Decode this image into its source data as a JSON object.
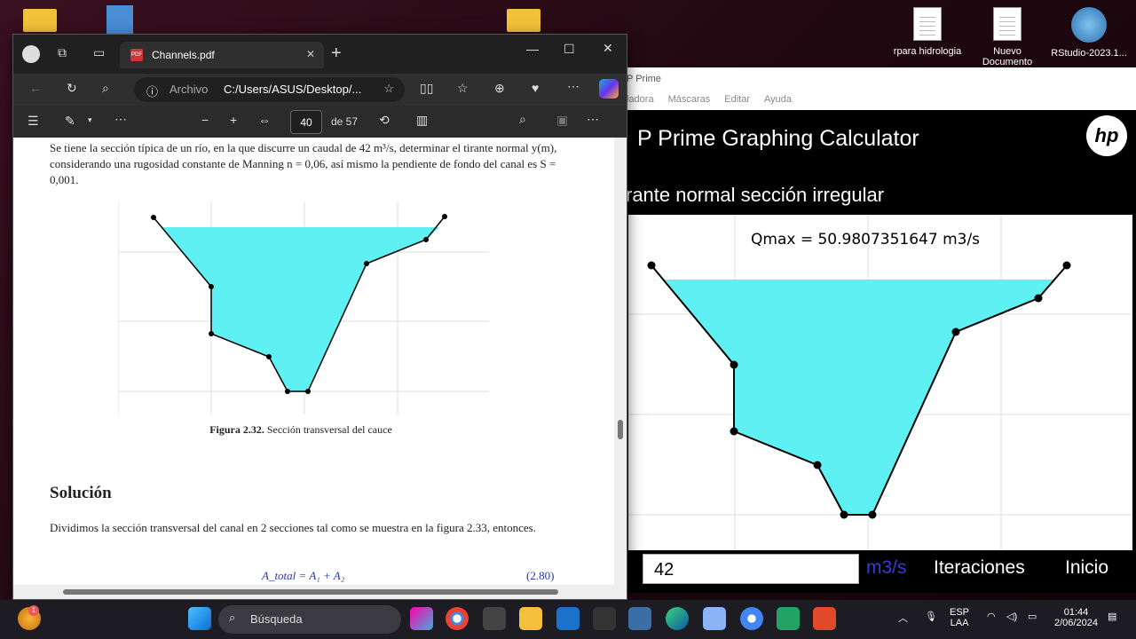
{
  "desktop": {
    "icons": [
      {
        "label": "rpara hidrologia",
        "type": "doc"
      },
      {
        "label": "Nuevo Documento",
        "type": "doc"
      },
      {
        "label": "RStudio-2023.1...",
        "type": "app"
      }
    ]
  },
  "browser": {
    "tab_title": "Channels.pdf",
    "address_label": "Archivo",
    "address_path": "C:/Users/ASUS/Desktop/...",
    "page_current": "40",
    "page_total": "de 57"
  },
  "pdf": {
    "para1": "Se tiene la sección típica de un río, en la que discurre un caudal de 42 m³/s, determinar el tirante normal y(m), considerando una rugosidad constante de Manning n = 0,06, así mismo la pendiente de fondo del canal es S = 0,001.",
    "fig_label": "Figura 2.32.",
    "fig_caption": "Sección transversal del cauce",
    "solution_heading": "Solución",
    "para2": "Dividimos la sección transversal del canal en 2 secciones tal como se muestra en la figura 2.33, entonces.",
    "equation": "A_total = A₁ + A₂",
    "eq_number": "(2.80)"
  },
  "hp": {
    "window_title": "P Prime",
    "menu": [
      "ladora",
      "Máscaras",
      "Editar",
      "Ayuda"
    ],
    "app_title": "P Prime Graphing Calculator",
    "logo": "hp",
    "subtitle": "rante normal sección irregular",
    "result": "Qmax = 50.9807351647 m3/s",
    "input_value": "42",
    "unit": "m3/s",
    "btn_iter": "Iteraciones",
    "btn_home": "Inicio"
  },
  "taskbar": {
    "search_placeholder": "Búsqueda",
    "lang": "ESP",
    "lang2": "LAA",
    "time": "01:44",
    "date": "2/06/2024",
    "badge": "1"
  },
  "colors": {
    "water": "#5ef0f2",
    "edge_dark": "#202020"
  }
}
